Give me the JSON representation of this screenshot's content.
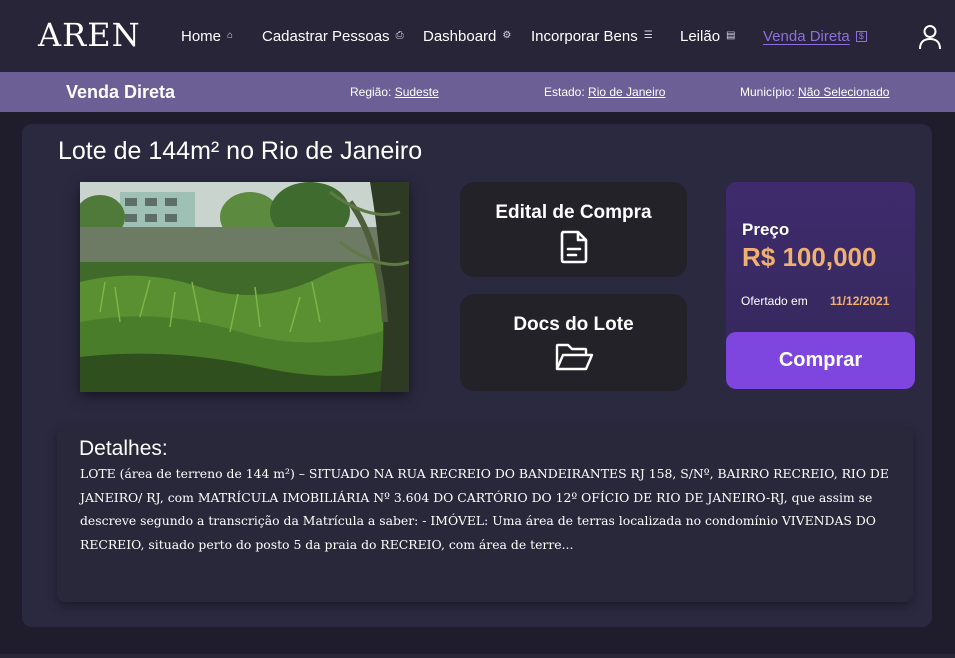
{
  "nav": {
    "logo": "AREN",
    "items": [
      {
        "label": "Home",
        "icon": "home-icon",
        "glyph": "⌂"
      },
      {
        "label": "Cadastrar Pessoas",
        "icon": "register-icon",
        "glyph": "⎙"
      },
      {
        "label": "Dashboard",
        "icon": "dashboard-icon",
        "glyph": "⚙"
      },
      {
        "label": "Incorporar Bens",
        "icon": "incorporate-icon",
        "glyph": "☰"
      },
      {
        "label": "Leilão",
        "icon": "auction-icon",
        "glyph": "▤"
      },
      {
        "label": "Venda Direta",
        "icon": "sale-icon",
        "glyph": "$",
        "active": true
      }
    ],
    "user_icon": "user-icon"
  },
  "subbar": {
    "title": "Venda Direta",
    "regiao_label": "Região: ",
    "regiao_value": "Sudeste",
    "estado_label": "Estado: ",
    "estado_value": "Rio de Janeiro",
    "municipio_label": "Município: ",
    "municipio_value": "Não Selecionado"
  },
  "lote": {
    "title": "Lote de 144m² no Rio de Janeiro",
    "edital_label": "Edital de Compra",
    "docs_label": "Docs do Lote",
    "price_label": "Preço",
    "price_value": "R$ 100,000",
    "offer_label": "Ofertado em",
    "offer_date": "11/12/2021",
    "buy_label": "Comprar"
  },
  "details": {
    "title": "Detalhes:",
    "text": "LOTE (área de terreno de 144 m²) – SITUADO NA RUA RECREIO DO BANDEIRANTES RJ 158, S/Nº, BAIRRO RECREIO, RIO DE JANEIRO/ RJ, com MATRÍCULA IMOBILIÁRIA Nº 3.604 DO CARTÓRIO DO 12º OFÍCIO DE RIO DE JANEIRO-RJ, que assim se descreve segundo a transcrição da Matrícula a saber: - IMÓVEL: Uma área de terras localizada no condomínio VIVENDAS DO RECREIO, situado perto do posto 5 da praia do RECREIO, com área de terre..."
  },
  "colors": {
    "accent": "#7e45df",
    "price": "#f0b070",
    "subbar": "#6b5f95",
    "active_nav": "#8f6ee0"
  }
}
